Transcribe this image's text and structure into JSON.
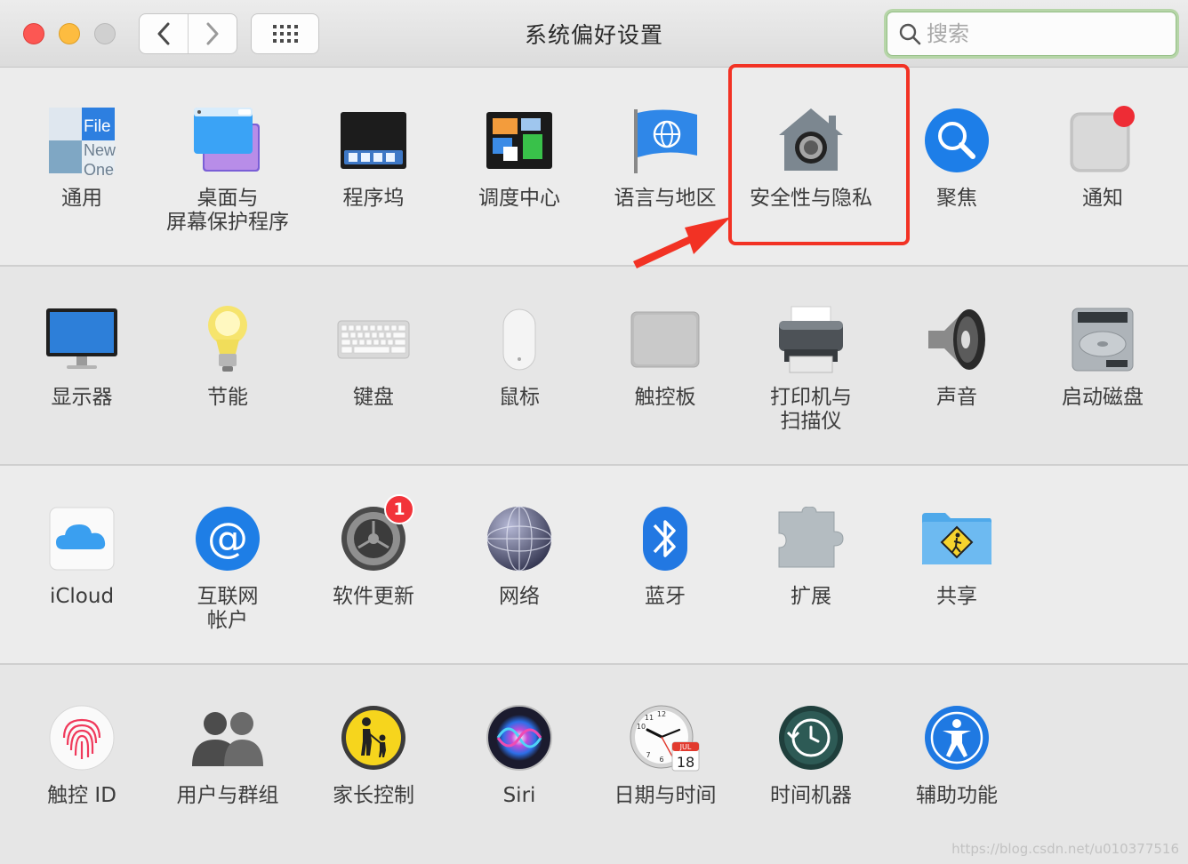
{
  "window": {
    "title": "系统偏好设置",
    "search_placeholder": "搜索"
  },
  "rows": [
    {
      "items": [
        {
          "label": "通用",
          "icon": "general-icon"
        },
        {
          "label": "桌面与\n屏幕保护程序",
          "icon": "desktop-screensaver-icon"
        },
        {
          "label": "程序坞",
          "icon": "dock-icon"
        },
        {
          "label": "调度中心",
          "icon": "mission-control-icon"
        },
        {
          "label": "语言与地区",
          "icon": "language-region-icon"
        },
        {
          "label": "安全性与隐私",
          "icon": "security-privacy-icon"
        },
        {
          "label": "聚焦",
          "icon": "spotlight-icon"
        },
        {
          "label": "通知",
          "icon": "notifications-icon"
        }
      ]
    },
    {
      "items": [
        {
          "label": "显示器",
          "icon": "displays-icon"
        },
        {
          "label": "节能",
          "icon": "energy-saver-icon"
        },
        {
          "label": "键盘",
          "icon": "keyboard-icon"
        },
        {
          "label": "鼠标",
          "icon": "mouse-icon"
        },
        {
          "label": "触控板",
          "icon": "trackpad-icon"
        },
        {
          "label": "打印机与\n扫描仪",
          "icon": "printers-scanners-icon"
        },
        {
          "label": "声音",
          "icon": "sound-icon"
        },
        {
          "label": "启动磁盘",
          "icon": "startup-disk-icon"
        }
      ]
    },
    {
      "items": [
        {
          "label": "iCloud",
          "icon": "icloud-icon"
        },
        {
          "label": "互联网\n帐户",
          "icon": "internet-accounts-icon"
        },
        {
          "label": "软件更新",
          "icon": "software-update-icon",
          "badge": "1"
        },
        {
          "label": "网络",
          "icon": "network-icon"
        },
        {
          "label": "蓝牙",
          "icon": "bluetooth-icon"
        },
        {
          "label": "扩展",
          "icon": "extensions-icon"
        },
        {
          "label": "共享",
          "icon": "sharing-icon"
        }
      ]
    },
    {
      "items": [
        {
          "label": "触控 ID",
          "icon": "touch-id-icon"
        },
        {
          "label": "用户与群组",
          "icon": "users-groups-icon"
        },
        {
          "label": "家长控制",
          "icon": "parental-controls-icon"
        },
        {
          "label": "Siri",
          "icon": "siri-icon"
        },
        {
          "label": "日期与时间",
          "icon": "date-time-icon"
        },
        {
          "label": "时间机器",
          "icon": "time-machine-icon"
        },
        {
          "label": "辅助功能",
          "icon": "accessibility-icon"
        }
      ]
    }
  ],
  "icon_text": {
    "general_file": "File",
    "general_new": "New",
    "general_one": "One",
    "calendar_month": "JUL",
    "calendar_day": "18",
    "clock_12": "12",
    "clock_11": "11",
    "clock_10": "10",
    "clock_7": "7",
    "clock_6": "6"
  },
  "watermark": "https://blog.csdn.net/u010377516",
  "colors": {
    "highlight": "#f23224",
    "search_focus": "#93be85",
    "close": "#fc5753",
    "minimize": "#fdbc40"
  }
}
